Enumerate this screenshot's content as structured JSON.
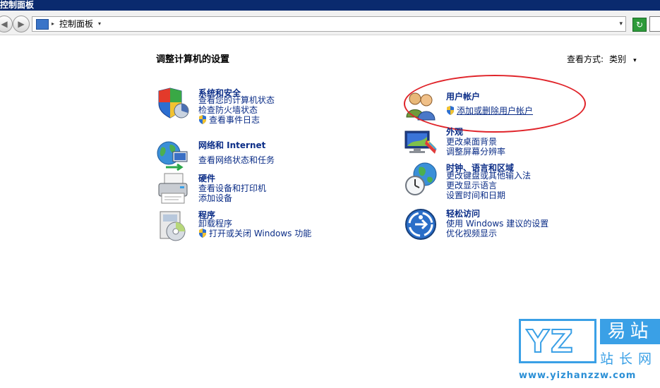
{
  "window": {
    "title": "控制面板"
  },
  "address_bar": {
    "breadcrumb": "控制面板",
    "separator": "▸",
    "dropdown": "▾",
    "back": "◀",
    "forward": "▶",
    "refresh": "↻"
  },
  "page": {
    "title": "调整计算机的设置",
    "view_by_label": "查看方式:",
    "view_by_value": "类别",
    "view_by_arrow": "▾"
  },
  "categories_left": [
    {
      "title": "系统和安全",
      "links": [
        "查看您的计算机状态",
        "检查防火墙状态",
        "查看事件日志"
      ],
      "icon": "system-security-icon"
    },
    {
      "title": "网络和 Internet",
      "links": [
        "查看网络状态和任务"
      ],
      "icon": "network-icon"
    },
    {
      "title": "硬件",
      "links": [
        "查看设备和打印机",
        "添加设备"
      ],
      "icon": "hardware-printer-icon"
    },
    {
      "title": "程序",
      "links": [
        "卸载程序",
        "打开或关闭 Windows 功能"
      ],
      "icon": "programs-icon"
    }
  ],
  "categories_right": [
    {
      "title": "用户帐户",
      "links": [
        "添加或删除用户帐户"
      ],
      "icon": "user-accounts-icon"
    },
    {
      "title": "外观",
      "links": [
        "更改桌面背景",
        "调整屏幕分辨率"
      ],
      "icon": "appearance-icon"
    },
    {
      "title": "时钟、语言和区域",
      "links": [
        "更改键盘或其他输入法",
        "更改显示语言",
        "设置时间和日期"
      ],
      "icon": "clock-language-icon"
    },
    {
      "title": "轻松访问",
      "links": [
        "使用 Windows 建议的设置",
        "优化视频显示"
      ],
      "icon": "ease-of-access-icon"
    }
  ],
  "colors": {
    "link": "#0b2d87",
    "highlight": "#e0242a",
    "titlebar": "#0a2a6e"
  }
}
